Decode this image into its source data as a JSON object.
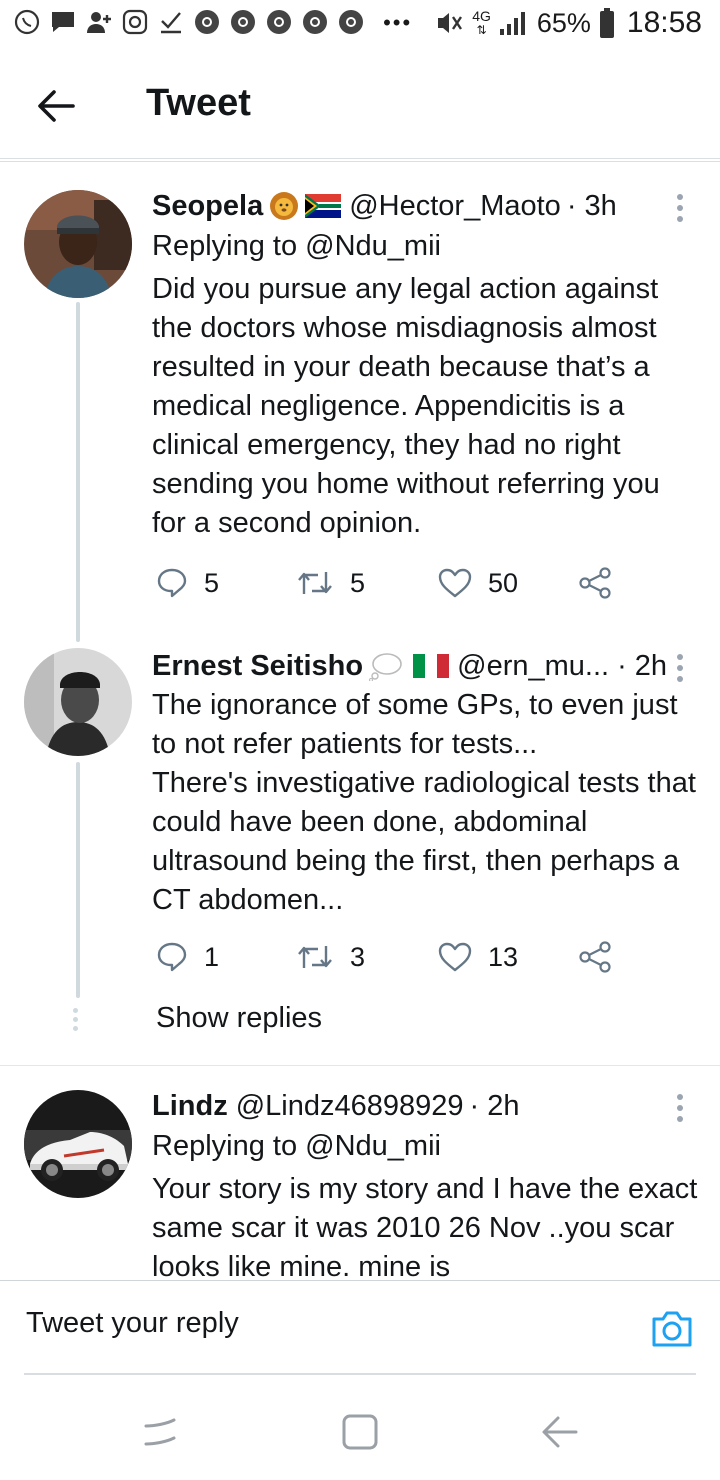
{
  "status_bar": {
    "dots": "•••",
    "network": "4G",
    "battery_pct": "65%",
    "time": "18:58"
  },
  "header": {
    "title": "Tweet"
  },
  "tweets": [
    {
      "name": "Seopela",
      "handle": "@Hector_Maoto",
      "time": "· 3h",
      "reply_to": "Replying to @Ndu_mii",
      "text": "Did you pursue any legal action against the doctors whose misdiagnosis almost resulted in your death because that’s a medical negligence. Appendicitis is a clinical emergency, they had no right sending you home without referring you for a second opinion.",
      "replies": "5",
      "retweets": "5",
      "likes": "50"
    },
    {
      "name": "Ernest Seitisho",
      "handle": "@ern_mu...",
      "time": "· 2h",
      "text": "The ignorance of some GPs, to even just to not refer patients for tests...\nThere's investigative radiological tests that could have been done, abdominal ultrasound being the first, then perhaps a CT abdomen...",
      "replies": "1",
      "retweets": "3",
      "likes": "13",
      "show_replies": "Show replies"
    },
    {
      "name": "Lindz",
      "handle": "@Lindz46898929",
      "time": "· 2h",
      "reply_to": "Replying to @Ndu_mii",
      "text": "Your story is my story and I have the exact same scar it was 2010 26 Nov ..you scar looks like mine. mine  is"
    }
  ],
  "composer": {
    "placeholder": "Tweet your reply"
  },
  "colors": {
    "accent": "#1da1f2",
    "icon_gray": "#657786",
    "thread_line": "#cfd9de"
  }
}
